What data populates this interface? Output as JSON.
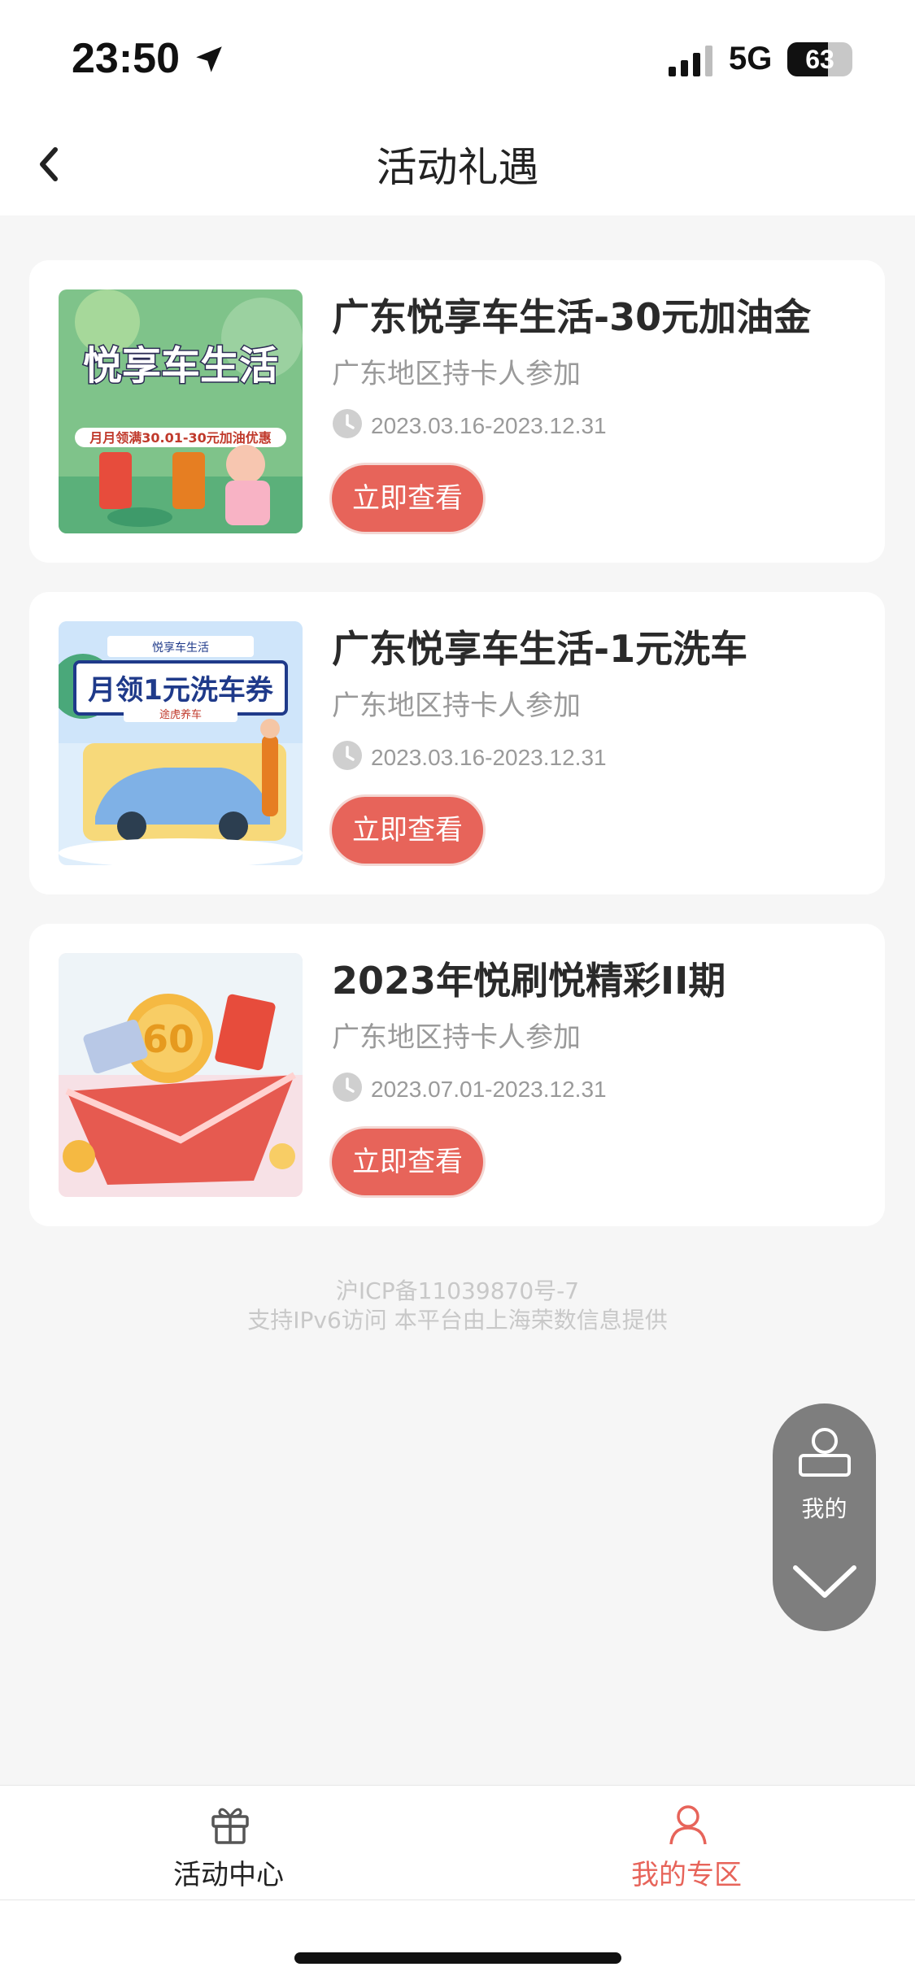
{
  "status_bar": {
    "time": "23:50",
    "network": "5G",
    "battery": "63",
    "battery_level": 0.63
  },
  "header": {
    "title": "活动礼遇"
  },
  "activities": [
    {
      "title": "广东悦享车生活-30元加油金",
      "subtitle": "广东地区持卡人参加",
      "date": "2023.03.16-2023.12.31",
      "button": "立即查看",
      "image_text": {
        "headline": "悦享车生活",
        "ribbon": "月月领满30.01-30元加油优惠"
      }
    },
    {
      "title": "广东悦享车生活-1元洗车",
      "subtitle": "广东地区持卡人参加",
      "date": "2023.03.16-2023.12.31",
      "button": "立即查看",
      "image_text": {
        "top": "悦享车生活",
        "headline": "月领1元洗车券",
        "sub": "途虎养车"
      }
    },
    {
      "title": "2023年悦刷悦精彩II期",
      "subtitle": "广东地区持卡人参加",
      "date": "2023.07.01-2023.12.31",
      "button": "立即查看",
      "image_text": {
        "coin": "60"
      }
    }
  ],
  "footer": {
    "icp": "沪ICP备11039870号-7",
    "support": "支持IPv6访问 本平台由上海荣数信息提供"
  },
  "float_menu": {
    "label": "我的"
  },
  "tab_bar": {
    "tabs": [
      {
        "label": "活动中心",
        "icon": "gift-icon",
        "active": false,
        "color": "#222222"
      },
      {
        "label": "我的专区",
        "icon": "user-icon",
        "active": true,
        "color": "#e7645a"
      }
    ]
  },
  "colors": {
    "accent": "#e7645a",
    "background": "#f6f6f6",
    "card": "#ffffff",
    "muted_text": "#9a9a9a"
  }
}
